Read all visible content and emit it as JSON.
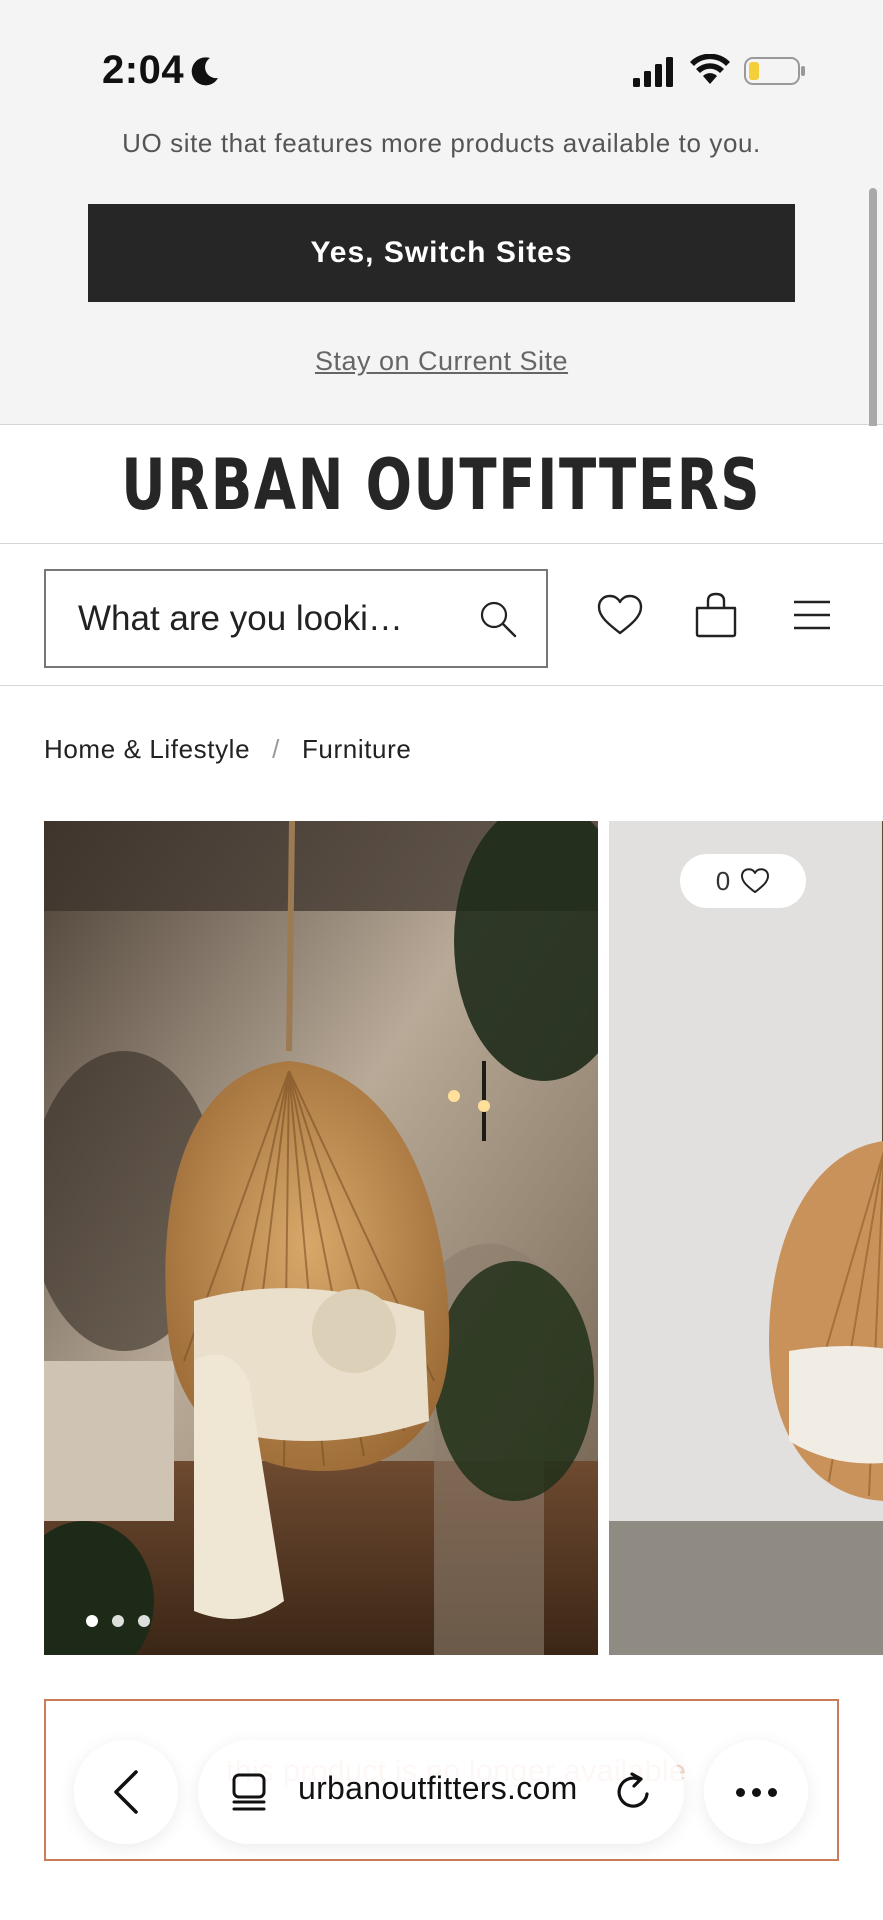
{
  "status_bar": {
    "time": "2:04",
    "icons": [
      "moon-icon",
      "signal-icon",
      "wifi-icon",
      "battery-icon"
    ],
    "battery_color": "#f5cf3a"
  },
  "site_banner": {
    "message": "UO site that features more products available to you.",
    "switch_label": "Yes, Switch Sites",
    "stay_label": "Stay on Current Site"
  },
  "header": {
    "logo": "URBAN OUTFITTERS",
    "search_placeholder": "What are you looki…",
    "icons": [
      "search-icon",
      "heart-icon",
      "bag-icon",
      "menu-icon"
    ]
  },
  "breadcrumb": {
    "items": [
      "Home & Lifestyle",
      "Furniture"
    ],
    "separator": "/"
  },
  "gallery": {
    "favorite_count": "0",
    "slide_count": 3,
    "active_slide": 1
  },
  "notice": {
    "text": "this product is no longer available"
  },
  "browser": {
    "url": "urbanoutfitters.com"
  },
  "colors": {
    "banner_bg": "#f4f4f4",
    "button_bg": "#262626",
    "notice_border": "#c97b5a"
  }
}
